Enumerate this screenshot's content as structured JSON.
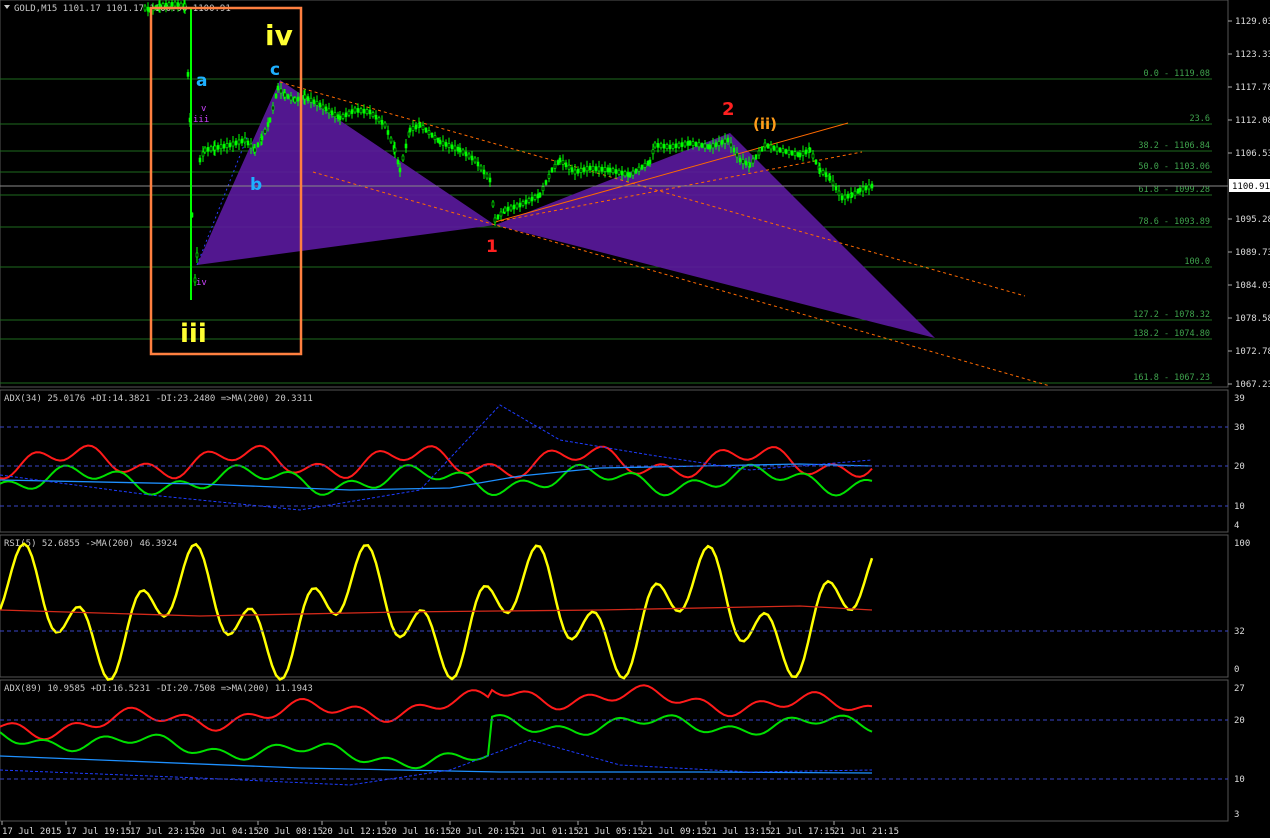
{
  "symbol_header": "GOLD,M15  1101.17 1101.17 1100.90 1100.91",
  "colors": {
    "background": "#000000",
    "candle_up": "#00ff00",
    "grid": "#1e6a1e",
    "adx_plus": "#00e000",
    "adx_minus": "#ff1a1a",
    "ma_line": "#1e90ff",
    "rsi_line": "#ffff00",
    "pattern_fill": "#5b1a9e",
    "box_stroke": "#ff8040",
    "trend_dotted": "#ff6a00"
  },
  "price_axis": {
    "ticks": [
      "1129.03",
      "1123.33",
      "1117.78",
      "1112.08",
      "1106.53",
      "1100.91",
      "1095.28",
      "1089.73",
      "1084.03",
      "1078.58",
      "1072.78",
      "1067.23"
    ],
    "current": "1100.91"
  },
  "fib_levels": [
    {
      "label": "0.0 - 1119.08"
    },
    {
      "label": "23.6"
    },
    {
      "label": "38.2 - 1106.84"
    },
    {
      "label": "50.0 - 1103.06"
    },
    {
      "label": "61.8 - 1099.28"
    },
    {
      "label": "78.6 - 1093.89"
    },
    {
      "label": "100.0"
    },
    {
      "label": "127.2 - 1078.32"
    },
    {
      "label": "138.2 - 1074.80"
    },
    {
      "label": "161.8 - 1067.23"
    }
  ],
  "wave_labels": {
    "iv": "iv",
    "iii": "iii",
    "a": "a",
    "b": "b",
    "c": "c",
    "w1": "1",
    "w2": "2",
    "wii": "(ii)",
    "iii_small": "iii",
    "v_small": "v",
    "iv_small": "iv"
  },
  "indicators": {
    "adx34": {
      "header": "ADX(34) 25.0176  +DI:14.3821  -DI:23.2480  =>MA(200) 20.3311",
      "ticks": [
        "39",
        "30",
        "20",
        "10",
        "4"
      ]
    },
    "rsi5": {
      "header": "RSI(5) 52.6855  ->MA(200) 46.3924",
      "ticks": [
        "100",
        "32",
        "0"
      ]
    },
    "adx89": {
      "header": "ADX(89) 10.9585  +DI:16.5231  -DI:20.7508  =>MA(200) 11.1943",
      "ticks": [
        "27",
        "20",
        "10",
        "3"
      ]
    }
  },
  "time_axis": [
    "17 Jul 2015",
    "17 Jul 19:15",
    "17 Jul 23:15",
    "20 Jul 04:15",
    "20 Jul 08:15",
    "20 Jul 12:15",
    "20 Jul 16:15",
    "20 Jul 20:15",
    "21 Jul 01:15",
    "21 Jul 05:15",
    "21 Jul 09:15",
    "21 Jul 13:15",
    "21 Jul 17:15",
    "21 Jul 21:15"
  ]
}
